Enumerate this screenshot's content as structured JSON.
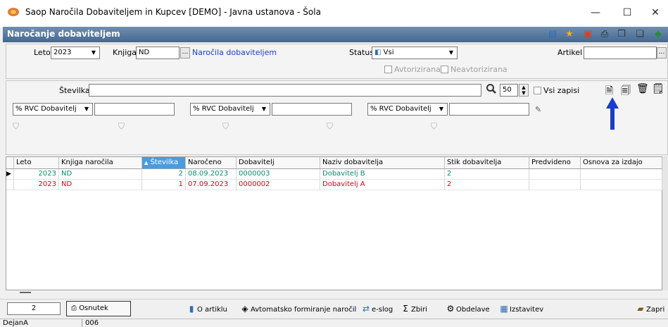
{
  "window": {
    "title": "Saop  Naročila Dobaviteljem in Kupcev [DEMO] - Javna ustanova - Šola",
    "minimize": "—",
    "maximize": "☐",
    "close": "✕"
  },
  "section": {
    "title": "Naročanje dobaviteljem",
    "toolbar_icons": [
      "tree-icon",
      "star-icon",
      "pdf-icon",
      "print-icon",
      "copy-icon",
      "paste-icon",
      "exit-icon"
    ]
  },
  "filters": {
    "leto_label": "Leto",
    "leto_value": "2023",
    "knjiga_label": "Knjiga",
    "knjiga_value": "ND",
    "knjiga_desc": "Naročila dobaviteljem",
    "status_label": "Status",
    "status_value": "Vsi",
    "artikel_label": "Artikel",
    "artikel_value": "",
    "avtorizirana": "Avtorizirana",
    "neavtorizirana": "Neavtorizirana"
  },
  "search": {
    "stevilka_label": "Številka",
    "stevilka_value": "",
    "count": "50",
    "vsi_zapisi": "Vsi zapisi",
    "rvc1": "% RVC Dobavitelj",
    "rvc2": "% RVC Dobavitelj",
    "rvc3": "% RVC Dobavitelj"
  },
  "grid": {
    "columns": [
      "Leto",
      "Knjiga naročila",
      "Številka",
      "Naročeno",
      "Dobavitelj",
      "Naziv dobavitelja",
      "Stik dobavitelja",
      "Predvideno",
      "Osnova za izdajo"
    ],
    "rows": [
      {
        "leto": "2023",
        "knjiga": "ND",
        "stevilka": "2",
        "naroceno": "08.09.2023",
        "dobavitelj": "0000003",
        "naziv": "Dobavitelj B",
        "stik": "2",
        "predvideno": "",
        "osnova": "",
        "color": "green"
      },
      {
        "leto": "2023",
        "knjiga": "ND",
        "stevilka": "1",
        "naroceno": "07.09.2023",
        "dobavitelj": "0000002",
        "naziv": "Dobavitelj A",
        "stik": "2",
        "predvideno": "",
        "osnova": "",
        "color": "red"
      }
    ]
  },
  "bottom": {
    "count": "2",
    "osnutek": "Osnutek",
    "o_artiklu": "O artiklu",
    "avtomatsko": "Avtomatsko formiranje naročil",
    "eslog": "e-slog",
    "zbiri": "Zbiri",
    "obdelave": "Obdelave",
    "izstavitev": "Izstavitev",
    "zapri": "Zapri"
  },
  "status": {
    "user": "DejanA",
    "code": "006"
  },
  "colors": {
    "header": "#45688f",
    "sorted": "#4a9be0",
    "green_row": "#0a8a6a",
    "red_row": "#e0001a",
    "arrow": "#1a3ccf"
  }
}
